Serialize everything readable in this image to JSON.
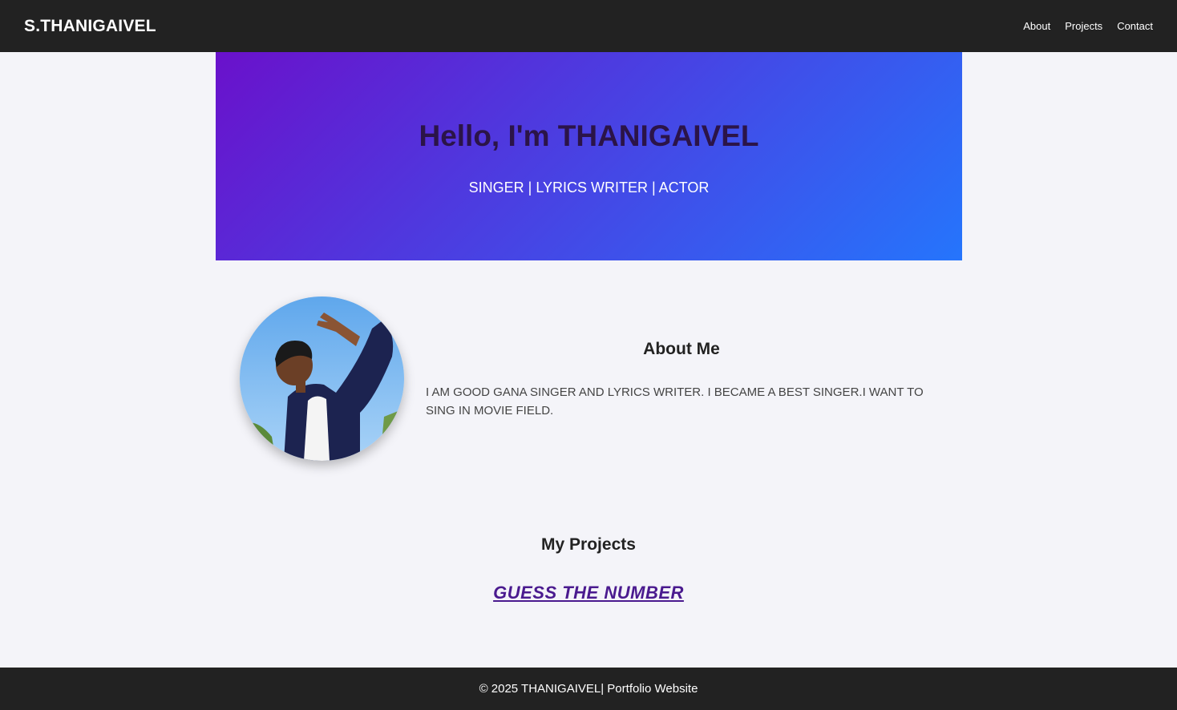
{
  "header": {
    "brand": "S.THANIGAIVEL",
    "nav": [
      "About",
      "Projects",
      "Contact"
    ]
  },
  "hero": {
    "greeting": "Hello, I'm THANIGAIVEL",
    "tagline": "SINGER | LYRICS WRITER | ACTOR"
  },
  "about": {
    "title": "About Me",
    "text": "I AM GOOD GANA SINGER AND LYRICS WRITER. I BECAME A BEST SINGER.I WANT TO SING IN MOVIE FIELD."
  },
  "projects": {
    "title": "My Projects",
    "items": [
      "GUESS THE NUMBER"
    ]
  },
  "footer": {
    "text": "© 2025 THANIGAIVEL| Portfolio Website"
  },
  "colors": {
    "bar": "#222222",
    "page_bg": "#f4f4f9",
    "hero_gradient_start": "#6a11cb",
    "hero_gradient_end": "#2575fc",
    "project_link": "#4a1a8f"
  }
}
